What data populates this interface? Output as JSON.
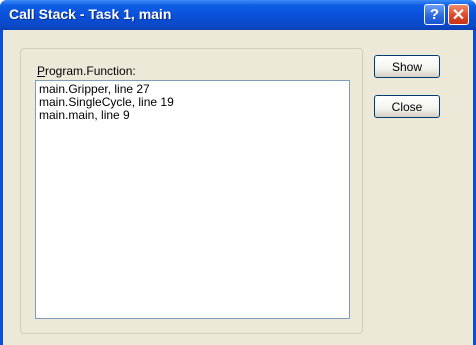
{
  "window": {
    "title": "Call Stack - Task 1, main",
    "help_button": "?",
    "close_button": "✕"
  },
  "call_stack": {
    "label": "Program.Function:",
    "items": [
      "main.Gripper, line 27",
      "main.SingleCycle, line 19",
      "main.main, line 9"
    ]
  },
  "buttons": {
    "show_label": "Show",
    "close_label": "Close"
  }
}
